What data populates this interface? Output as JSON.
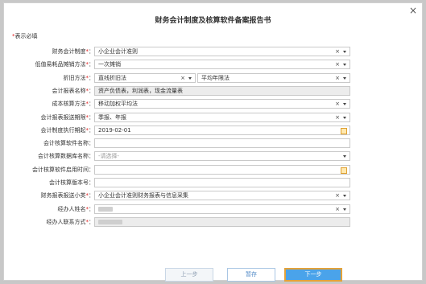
{
  "dialog": {
    "title": "财务会计制度及核算软件备案报告书",
    "close_label": "×",
    "required_note_star": "*",
    "required_note": "表示必填"
  },
  "fields": [
    {
      "label": "财务会计制度",
      "required": true,
      "value": "小企业会计准则",
      "type": "select",
      "clearable": true
    },
    {
      "label": "低值易耗品摊销方法",
      "required": true,
      "value": "一次摊销",
      "type": "select",
      "clearable": true
    },
    {
      "label": "折旧方法",
      "required": true,
      "value": "直线折旧法",
      "value2": "平均年限法",
      "type": "dual"
    },
    {
      "label": "会计报表名称",
      "required": true,
      "value": "资产负债表，利润表，现金流量表",
      "type": "readonly"
    },
    {
      "label": "成本核算方法",
      "required": true,
      "value": "移动加权平均法",
      "type": "select",
      "clearable": true
    },
    {
      "label": "会计报表报送期限",
      "required": true,
      "value": "季报、年报",
      "type": "select",
      "clearable": true
    },
    {
      "label": "会计制度执行期起",
      "required": true,
      "value": "2019-02-01",
      "type": "date"
    },
    {
      "label": "会计核算软件名称",
      "required": false,
      "value": "",
      "type": "text"
    },
    {
      "label": "会计核算数据库名称",
      "required": false,
      "value": "-请选择-",
      "type": "select-placeholder"
    },
    {
      "label": "会计核算软件启用时间",
      "required": false,
      "value": "",
      "type": "date"
    },
    {
      "label": "会计核算版本号",
      "required": false,
      "value": "",
      "type": "text"
    },
    {
      "label": "财务报表报送小类",
      "required": true,
      "value": "小企业会计准则财务报表与信息采集",
      "type": "select",
      "clearable": true
    },
    {
      "label": "经办人姓名",
      "required": true,
      "value": "",
      "type": "select-blur",
      "clearable": true
    },
    {
      "label": "经办人联系方式",
      "required": true,
      "value": "",
      "type": "readonly-blur"
    }
  ],
  "buttons": {
    "prev": "上一步",
    "save": "暂存",
    "next": "下一步"
  },
  "colors": {
    "required_star": "#e02020",
    "next_button_bg": "#4aa3ea",
    "next_button_border": "#e3a23a"
  }
}
